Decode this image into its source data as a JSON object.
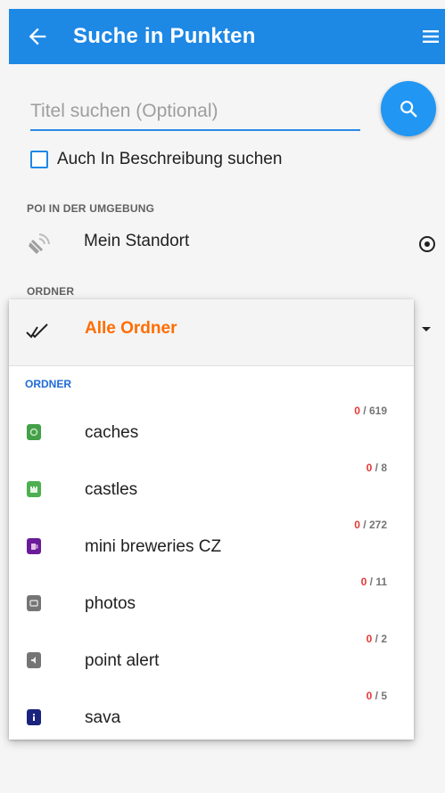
{
  "appbar": {
    "title": "Suche in Punkten"
  },
  "search": {
    "placeholder": "Titel suchen (Optional)"
  },
  "checkbox": {
    "label": "Auch In Beschreibung suchen"
  },
  "poi": {
    "section_label": "POI IN DER UMGEBUNG",
    "location_label": "Mein Standort"
  },
  "folders_section": {
    "label": "ORDNER"
  },
  "popup": {
    "all_label": "Alle Ordner",
    "sub_header": "ORDNER",
    "items": [
      {
        "name": "caches",
        "zero": "0",
        "total": " / 619",
        "color": "#43a047",
        "icon": "cache-icon"
      },
      {
        "name": "castles",
        "zero": "0",
        "total": " / 8",
        "color": "#4caf50",
        "icon": "castle-icon"
      },
      {
        "name": "mini breweries CZ",
        "zero": "0",
        "total": " / 272",
        "color": "#6a1b9a",
        "icon": "brewery-icon"
      },
      {
        "name": "photos",
        "zero": "0",
        "total": " / 11",
        "color": "#757575",
        "icon": "photo-icon"
      },
      {
        "name": "point alert",
        "zero": "0",
        "total": " / 2",
        "color": "#757575",
        "icon": "alert-icon"
      },
      {
        "name": "sava",
        "zero": "0",
        "total": " / 5",
        "color": "#1a237e",
        "icon": "info-icon"
      }
    ]
  },
  "colors": {
    "primary": "#1e88e5",
    "accent": "#ff6d00",
    "count_zero": "#e53935"
  }
}
